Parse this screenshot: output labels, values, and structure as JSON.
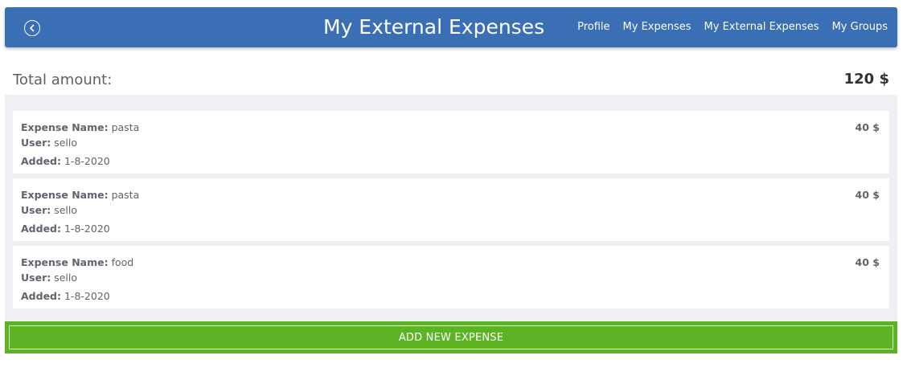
{
  "header": {
    "back_icon": "circle-arrow-left-icon",
    "title": "My External Expenses",
    "nav": [
      {
        "label": "Profile"
      },
      {
        "label": "My Expenses"
      },
      {
        "label": "My External Expenses"
      },
      {
        "label": "My Groups"
      }
    ],
    "color": "#3a6eb5"
  },
  "total": {
    "label": "Total amount:",
    "value": "120 $"
  },
  "expenses": [
    {
      "name_label": "Expense Name:",
      "name": "pasta",
      "user_label": "User:",
      "user": "sello",
      "added_label": "Added:",
      "added": "1-8-2020",
      "amount": "40 $"
    },
    {
      "name_label": "Expense Name:",
      "name": "pasta",
      "user_label": "User:",
      "user": "sello",
      "added_label": "Added:",
      "added": "1-8-2020",
      "amount": "40 $"
    },
    {
      "name_label": "Expense Name:",
      "name": "food",
      "user_label": "User:",
      "user": "sello",
      "added_label": "Added:",
      "added": "1-8-2020",
      "amount": "40 $"
    }
  ],
  "add_button": {
    "label": "ADD NEW EXPENSE",
    "color": "#5cb324"
  }
}
